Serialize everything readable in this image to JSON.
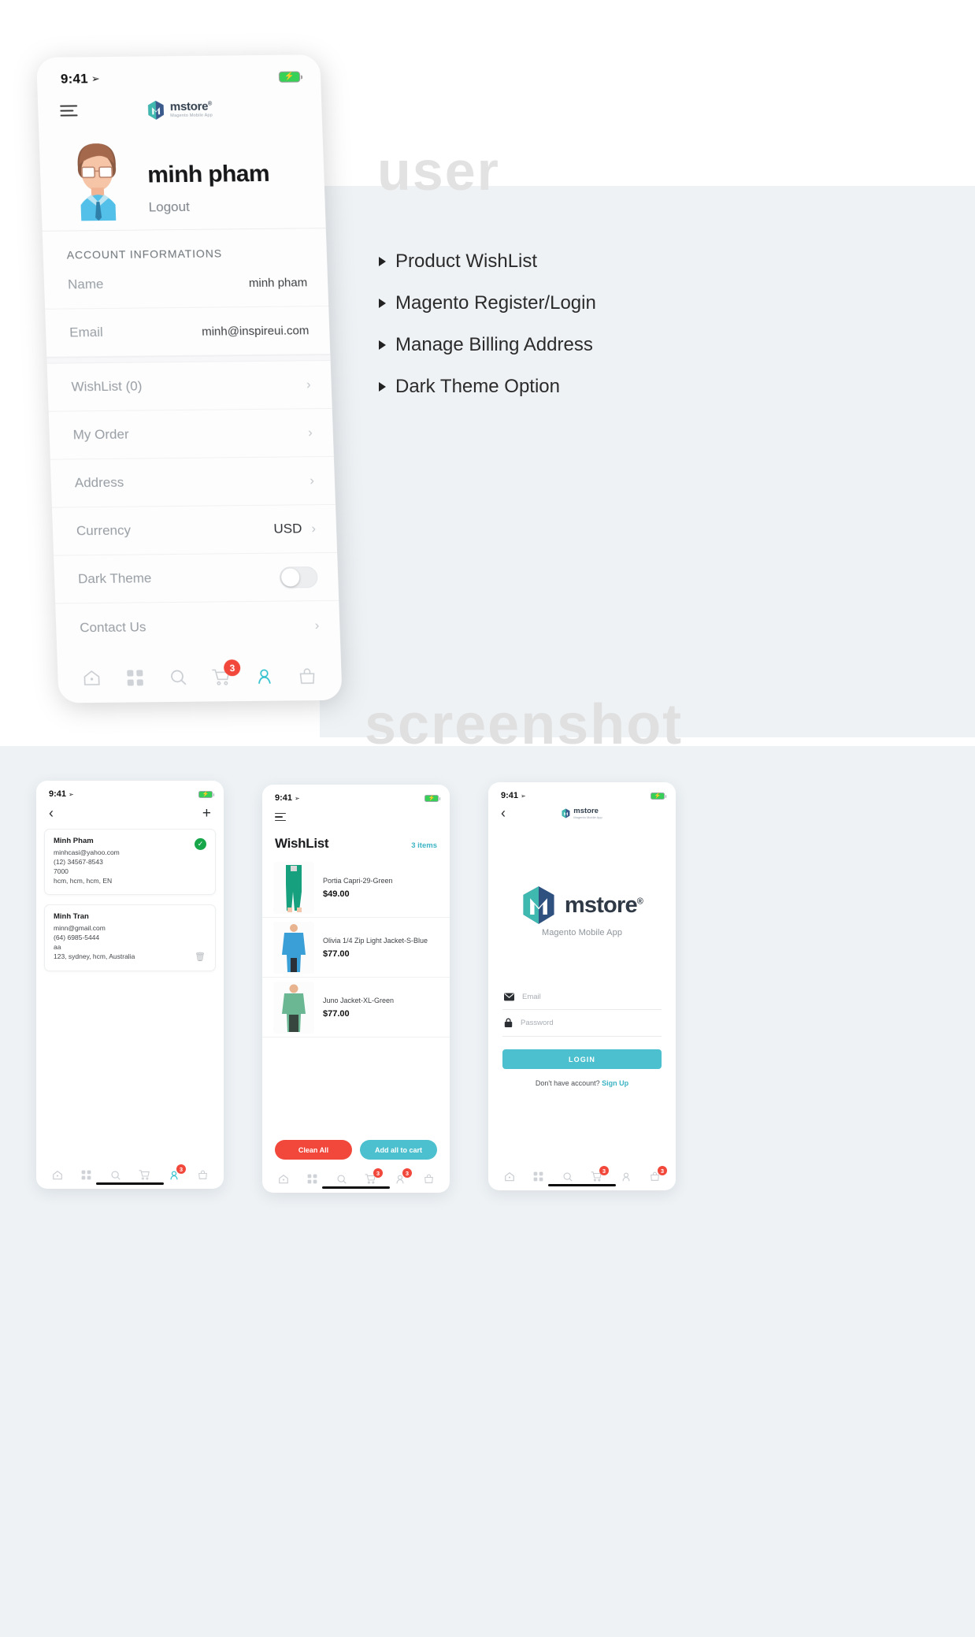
{
  "ghost_words": {
    "top": "user",
    "bottom": "screenshot"
  },
  "features": [
    "Product WishList",
    "Magento Register/Login",
    "Manage Billing Address",
    "Dark Theme Option"
  ],
  "brand": {
    "name": "mstore",
    "reg": "®",
    "tagline": "Magento Mobile App"
  },
  "hero": {
    "status_time": "9:41",
    "profile_name": "minh pham",
    "logout": "Logout",
    "section_title": "ACCOUNT INFORMATIONS",
    "info_rows": [
      {
        "label": "Name",
        "value": "minh pham"
      },
      {
        "label": "Email",
        "value": "minh@inspireui.com"
      }
    ],
    "menu_rows": [
      {
        "label": "WishList (0)",
        "value": "",
        "chevron": "›"
      },
      {
        "label": "My Order",
        "value": "",
        "chevron": "›"
      },
      {
        "label": "Address",
        "value": "",
        "chevron": "›"
      },
      {
        "label": "Currency",
        "value": "USD",
        "chevron": "›"
      },
      {
        "label": "Dark Theme",
        "value": "",
        "chevron": ""
      },
      {
        "label": "Contact Us",
        "value": "",
        "chevron": "›"
      }
    ],
    "cart_badge": "3",
    "tabs": [
      "home-icon",
      "grid-icon",
      "search-icon",
      "cart-icon",
      "user-icon",
      "bag-icon"
    ]
  },
  "address_screen": {
    "status_time": "9:41",
    "back": "‹",
    "add": "+",
    "cards": [
      {
        "name": "Minh Pham",
        "email": "minhcasi@yahoo.com",
        "phone": "(12) 34567-8543",
        "zip": "7000",
        "location": "hcm, hcm, hcm, EN",
        "default": true
      },
      {
        "name": "Minh Tran",
        "email": "minn@gmail.com",
        "phone": "(64) 6985-5444",
        "zip": "aa",
        "location": "123, sydney, hcm, Australia",
        "default": false
      }
    ],
    "cart_badge": "3"
  },
  "wishlist_screen": {
    "status_time": "9:41",
    "title": "WishList",
    "count": "3 items",
    "items": [
      {
        "name": "Portia Capri-29-Green",
        "price": "$49.00"
      },
      {
        "name": "Olivia 1/4 Zip Light Jacket-S-Blue",
        "price": "$77.00"
      },
      {
        "name": "Juno Jacket-XL-Green",
        "price": "$77.00"
      }
    ],
    "clean_all": "Clean All",
    "add_all": "Add all to cart",
    "cart_badge": "3",
    "user_badge": "3"
  },
  "login_screen": {
    "status_time": "9:41",
    "back": "‹",
    "logo_name": "mstore",
    "logo_reg": "®",
    "logo_sub": "Magento Mobile App",
    "email_placeholder": "Email",
    "password_placeholder": "Password",
    "login_button": "LOGIN",
    "signup_prompt": "Don't have account?",
    "signup_link": "Sign Up",
    "cart_badge": "3",
    "bag_badge": "3"
  },
  "colors": {
    "accent": "#4cc0ce",
    "danger": "#f2483b",
    "panel": "#eef2f5",
    "ghost": "#e2e2e2"
  }
}
